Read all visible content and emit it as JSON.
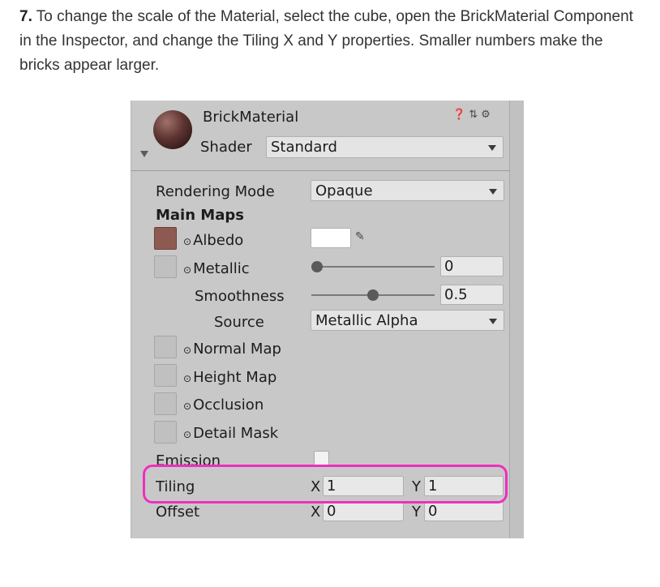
{
  "instruction": {
    "step_number": "7.",
    "text": "To change the scale of the Material, select the cube, open the BrickMaterial Component in the Inspector, and change the Tiling X and Y properties. Smaller numbers make the bricks appear larger."
  },
  "inspector": {
    "material_name": "BrickMaterial",
    "header_icons": [
      "help-icon",
      "preset-icon",
      "settings-icon"
    ],
    "shader_label": "Shader",
    "shader_value": "Standard",
    "rendering_mode_label": "Rendering Mode",
    "rendering_mode_value": "Opaque",
    "main_maps_label": "Main Maps",
    "albedo_label": "Albedo",
    "metallic_label": "Metallic",
    "metallic_value": "0",
    "metallic_level": 0,
    "smoothness_label": "Smoothness",
    "smoothness_value": "0.5",
    "smoothness_level": 0.5,
    "source_label": "Source",
    "source_value": "Metallic Alpha",
    "normal_map_label": "Normal Map",
    "height_map_label": "Height Map",
    "occlusion_label": "Occlusion",
    "detail_mask_label": "Detail Mask",
    "emission_label": "Emission",
    "tiling_label": "Tiling",
    "tiling_x_axis": "X",
    "tiling_x": "1",
    "tiling_y_axis": "Y",
    "tiling_y": "1",
    "offset_label": "Offset",
    "offset_x_axis": "X",
    "offset_x": "0",
    "offset_y_axis": "Y",
    "offset_y": "0",
    "picker_glyph": "⊙",
    "colors": {
      "highlight": "#ee2fbf",
      "panel_bg": "#c8c8c8",
      "brick_swatch": "#8d5a52",
      "albedo_color": "#ffffff"
    }
  }
}
